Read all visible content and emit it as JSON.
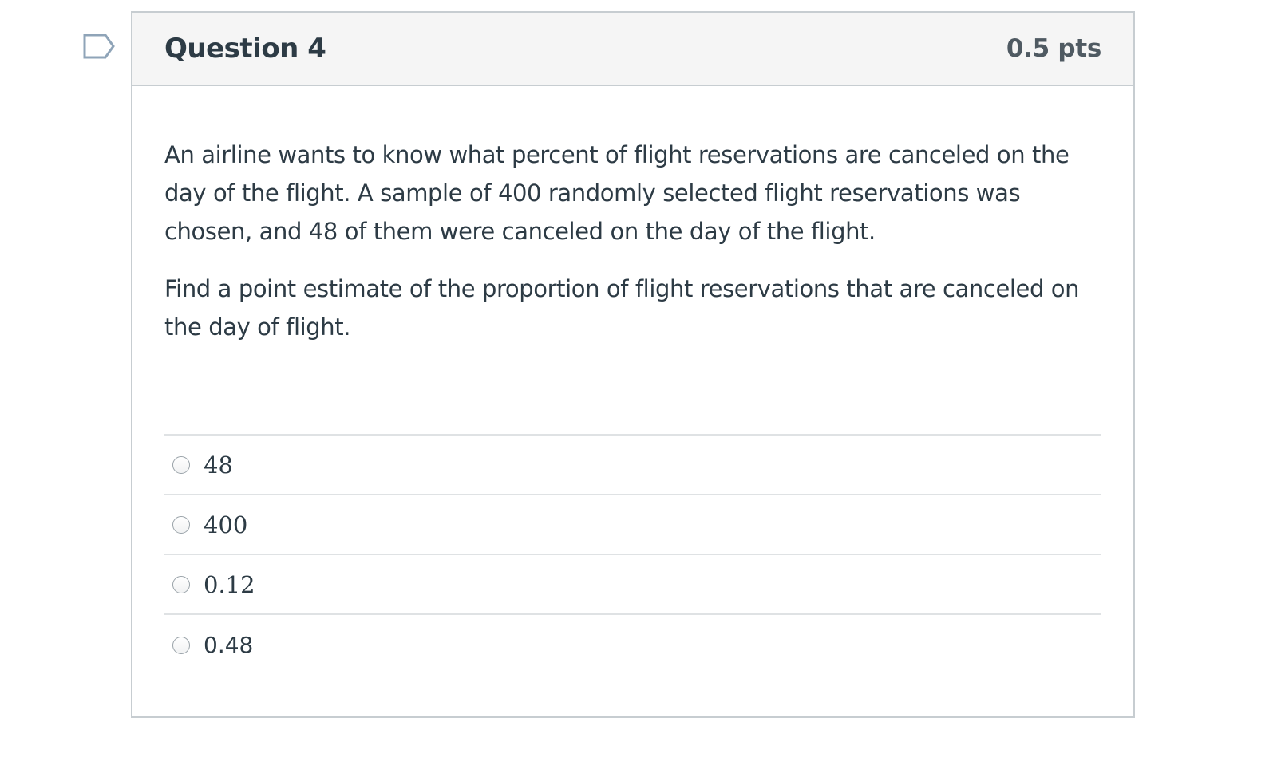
{
  "question": {
    "title": "Question 4",
    "points": "0.5 pts",
    "paragraphs": [
      "An airline wants to know what percent of flight reservations are canceled on the day of the flight. A sample of 400 randomly selected flight reservations was chosen, and 48 of them were canceled on the day of the flight.",
      "Find a point estimate of the proportion of flight reservations that are canceled on the day of flight."
    ],
    "answers": [
      {
        "label": "48",
        "selected": false
      },
      {
        "label": "400",
        "selected": false
      },
      {
        "label": "0.12",
        "selected": false
      },
      {
        "label": "0.48",
        "selected": false
      }
    ]
  },
  "flag": {
    "icon": "flag-question-icon",
    "flagged": false
  },
  "colors": {
    "header_bg": "#f5f5f5",
    "border": "#c7cdd1",
    "text": "#2d3b45",
    "flag_stroke": "#8fa4b8"
  }
}
